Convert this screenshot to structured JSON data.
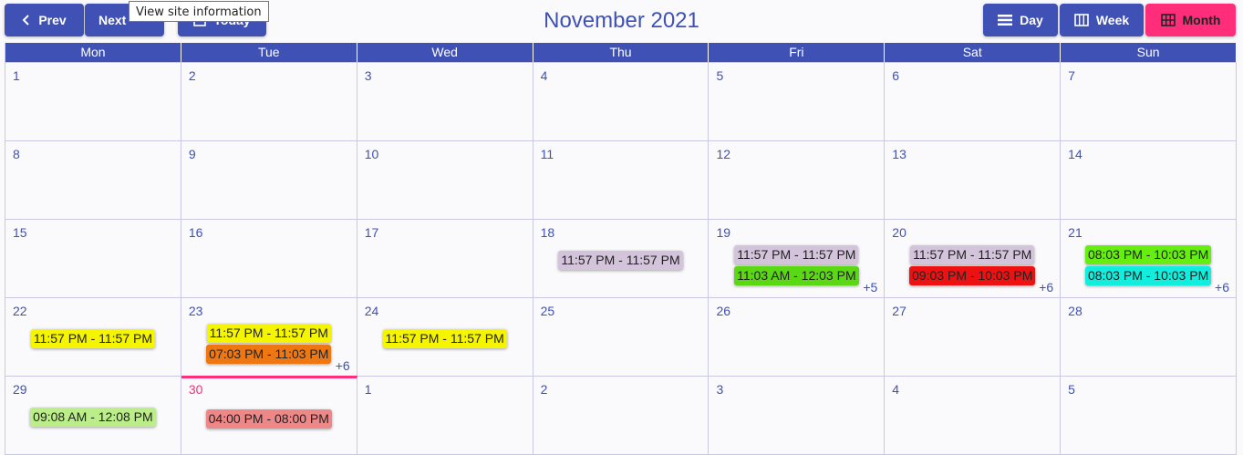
{
  "toolbar": {
    "prev_label": "Prev",
    "next_label": "Next",
    "today_label": "Today",
    "title": "November 2021",
    "day_label": "Day",
    "week_label": "Week",
    "month_label": "Month",
    "tooltip": "View site information"
  },
  "colors": {
    "primary": "#3f51b5",
    "active": "#ff2d7a"
  },
  "weekdays": [
    "Mon",
    "Tue",
    "Wed",
    "Thu",
    "Fri",
    "Sat",
    "Sun"
  ],
  "weeks": [
    {
      "days": [
        {
          "num": "1",
          "events": []
        },
        {
          "num": "2",
          "events": []
        },
        {
          "num": "3",
          "events": []
        },
        {
          "num": "4",
          "events": []
        },
        {
          "num": "5",
          "events": []
        },
        {
          "num": "6",
          "events": []
        },
        {
          "num": "7",
          "events": []
        }
      ]
    },
    {
      "days": [
        {
          "num": "8",
          "events": []
        },
        {
          "num": "9",
          "events": []
        },
        {
          "num": "10",
          "events": []
        },
        {
          "num": "11",
          "events": []
        },
        {
          "num": "12",
          "events": []
        },
        {
          "num": "13",
          "events": []
        },
        {
          "num": "14",
          "events": []
        }
      ]
    },
    {
      "days": [
        {
          "num": "15",
          "events": []
        },
        {
          "num": "16",
          "events": []
        },
        {
          "num": "17",
          "events": []
        },
        {
          "num": "18",
          "events": [
            {
              "time": "11:57 PM - 11:57 PM",
              "color": "#d3c4dc"
            }
          ]
        },
        {
          "num": "19",
          "events": [
            {
              "time": "11:57 PM - 11:57 PM",
              "color": "#d3c4dc"
            },
            {
              "time": "11:03 AM - 12:03 PM",
              "color": "#5bd814"
            }
          ],
          "more": "+5"
        },
        {
          "num": "20",
          "events": [
            {
              "time": "11:57 PM - 11:57 PM",
              "color": "#d3c4dc"
            },
            {
              "time": "09:03 PM - 10:03 PM",
              "color": "#ee1111"
            }
          ],
          "more": "+6"
        },
        {
          "num": "21",
          "events": [
            {
              "time": "08:03 PM - 10:03 PM",
              "color": "#66ee11"
            },
            {
              "time": "08:03 PM - 10:03 PM",
              "color": "#11eedd"
            }
          ],
          "more": "+6"
        }
      ]
    },
    {
      "days": [
        {
          "num": "22",
          "events": [
            {
              "time": "11:57 PM - 11:57 PM",
              "color": "#f5f500"
            }
          ]
        },
        {
          "num": "23",
          "events": [
            {
              "time": "11:57 PM - 11:57 PM",
              "color": "#f5f500"
            },
            {
              "time": "07:03 PM - 11:03 PM",
              "color": "#ee7711"
            }
          ],
          "more": "+6"
        },
        {
          "num": "24",
          "events": [
            {
              "time": "11:57 PM - 11:57 PM",
              "color": "#f5f500"
            }
          ]
        },
        {
          "num": "25",
          "events": []
        },
        {
          "num": "26",
          "events": []
        },
        {
          "num": "27",
          "events": []
        },
        {
          "num": "28",
          "events": []
        }
      ]
    },
    {
      "days": [
        {
          "num": "29",
          "events": [
            {
              "time": "09:08 AM - 12:08 PM",
              "color": "#bbee88"
            }
          ]
        },
        {
          "num": "30",
          "today": true,
          "events": [
            {
              "time": "04:00 PM - 08:00 PM",
              "color": "#ee8888"
            }
          ]
        },
        {
          "num": "1",
          "events": []
        },
        {
          "num": "2",
          "events": []
        },
        {
          "num": "3",
          "events": []
        },
        {
          "num": "4",
          "events": []
        },
        {
          "num": "5",
          "events": []
        }
      ]
    }
  ]
}
